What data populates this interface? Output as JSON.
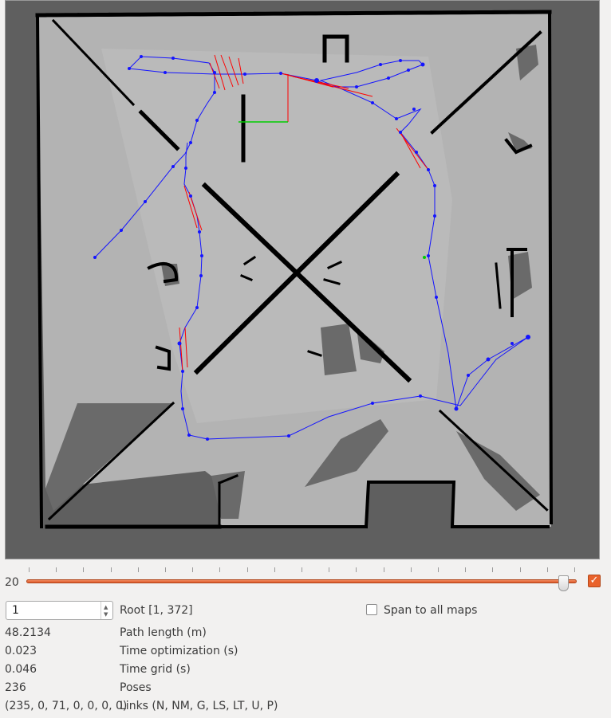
{
  "slider": {
    "value_label": "20",
    "position_fraction": 0.985,
    "checked": true
  },
  "root_spin": {
    "value": "1"
  },
  "root_label": "Root [1, 372]",
  "span_all_maps": {
    "label": "Span to all maps",
    "checked": false
  },
  "stats": [
    {
      "value": "48.2134",
      "label": "Path length (m)"
    },
    {
      "value": "0.023",
      "label": "Time optimization (s)"
    },
    {
      "value": "0.046",
      "label": "Time grid (s)"
    },
    {
      "value": "236",
      "label": "Poses"
    },
    {
      "value": "(235, 0, 71, 0, 0, 0, 0)",
      "label": "Links (N, NM, G, LS, LT, U, P)"
    }
  ],
  "colors": {
    "unknown": "#5f5f5f",
    "free": "#b2b2b2",
    "obstacle": "#000000",
    "path": "#1414ff",
    "loop_closure": "#ff0000",
    "origin_x_axis": "#ff0000",
    "origin_y_axis": "#00cc00",
    "accent": "#e9622b"
  }
}
